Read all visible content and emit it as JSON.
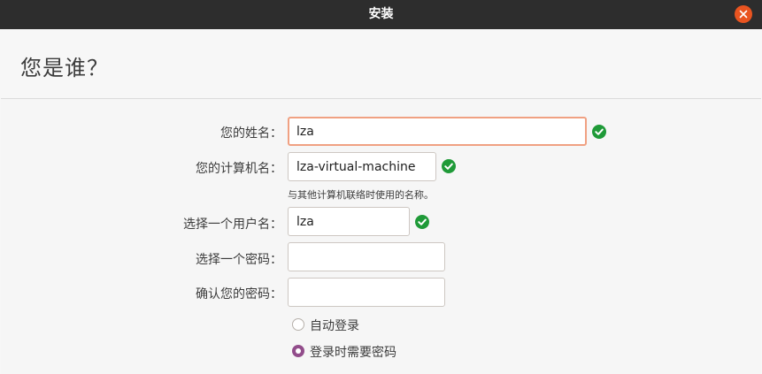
{
  "window": {
    "title": "安装"
  },
  "page": {
    "title": "您是谁？"
  },
  "form": {
    "name_label": "您的姓名：",
    "name_value": "lza",
    "computer_label": "您的计算机名：",
    "computer_value": "lza-virtual-machine",
    "computer_hint": "与其他计算机联络时使用的名称。",
    "username_label": "选择一个用户名：",
    "username_value": "lza",
    "password_label": "选择一个密码：",
    "password_value": "",
    "confirm_label": "确认您的密码：",
    "confirm_value": ""
  },
  "login_options": {
    "auto_login_label": "自动登录",
    "auto_login_selected": false,
    "require_password_label": "登录时需要密码",
    "require_password_selected": true
  },
  "icons": {
    "close": "close-icon",
    "valid": "check-circle-icon"
  },
  "colors": {
    "accent": "#e95420",
    "radio_selected": "#924d8b",
    "valid_check": "#1f9a38",
    "titlebar": "#2d2d2d",
    "focus_border": "#f0a182"
  }
}
